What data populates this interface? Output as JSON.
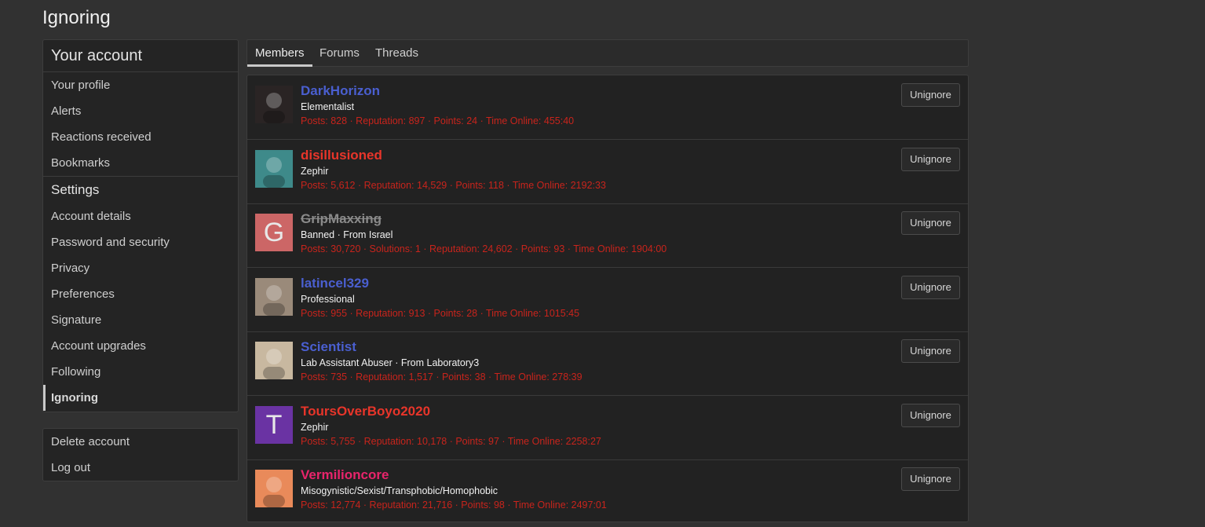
{
  "page_title": "Ignoring",
  "sidebar": {
    "account_heading": "Your account",
    "account_items": [
      "Your profile",
      "Alerts",
      "Reactions received",
      "Bookmarks"
    ],
    "settings_heading": "Settings",
    "settings_items": [
      "Account details",
      "Password and security",
      "Privacy",
      "Preferences",
      "Signature",
      "Account upgrades",
      "Following",
      "Ignoring"
    ],
    "active_item": "Ignoring",
    "bottom_items": [
      "Delete account",
      "Log out"
    ]
  },
  "tabs": [
    "Members",
    "Forums",
    "Threads"
  ],
  "active_tab": "Members",
  "members": [
    {
      "name": "DarkHorizon",
      "name_color": "#4a5fd0",
      "banned": false,
      "title": "Elementalist",
      "stats": "Posts: 828 · Reputation: 897 · Points: 24 · Time Online: 455:40",
      "avatar_letter": "",
      "avatar_color": "#2a2424",
      "button": "Unignore"
    },
    {
      "name": "disillusioned",
      "name_color": "#e8352a",
      "banned": false,
      "title": "Zephir",
      "stats": "Posts: 5,612 · Reputation: 14,529 · Points: 118 · Time Online: 2192:33",
      "avatar_letter": "",
      "avatar_color": "#3e8a8a",
      "button": "Unignore"
    },
    {
      "name": "GripMaxxing",
      "name_color": "#8a8a8a",
      "banned": true,
      "title": "Banned · From Israel",
      "stats": "Posts: 30,720 · Solutions: 1 · Reputation: 24,602 · Points: 93 · Time Online: 1904:00",
      "avatar_letter": "G",
      "avatar_color": "#cc6666",
      "button": "Unignore"
    },
    {
      "name": "latincel329",
      "name_color": "#4a5fd0",
      "banned": false,
      "title": "Professional",
      "stats": "Posts: 955 · Reputation: 913 · Points: 28 · Time Online: 1015:45",
      "avatar_letter": "",
      "avatar_color": "#9a8a7a",
      "button": "Unignore"
    },
    {
      "name": "Scientist",
      "name_color": "#4a5fd0",
      "banned": false,
      "title": "Lab Assistant Abuser · From Laboratory3",
      "stats": "Posts: 735 · Reputation: 1,517 · Points: 38 · Time Online: 278:39",
      "avatar_letter": "",
      "avatar_color": "#c8b8a0",
      "button": "Unignore"
    },
    {
      "name": "ToursOverBoyo2020",
      "name_color": "#e8352a",
      "banned": false,
      "title": "Zephir",
      "stats": "Posts: 5,755 · Reputation: 10,178 · Points: 97 · Time Online: 2258:27",
      "avatar_letter": "T",
      "avatar_color": "#6a33a3",
      "button": "Unignore"
    },
    {
      "name": "Vermilioncore",
      "name_color": "#e8246b",
      "banned": false,
      "title": "Misogynistic/Sexist/Transphobic/Homophobic",
      "stats": "Posts: 12,774 · Reputation: 21,716 · Points: 98 · Time Online: 2497:01",
      "avatar_letter": "",
      "avatar_color": "#e98a5a",
      "button": "Unignore"
    }
  ]
}
